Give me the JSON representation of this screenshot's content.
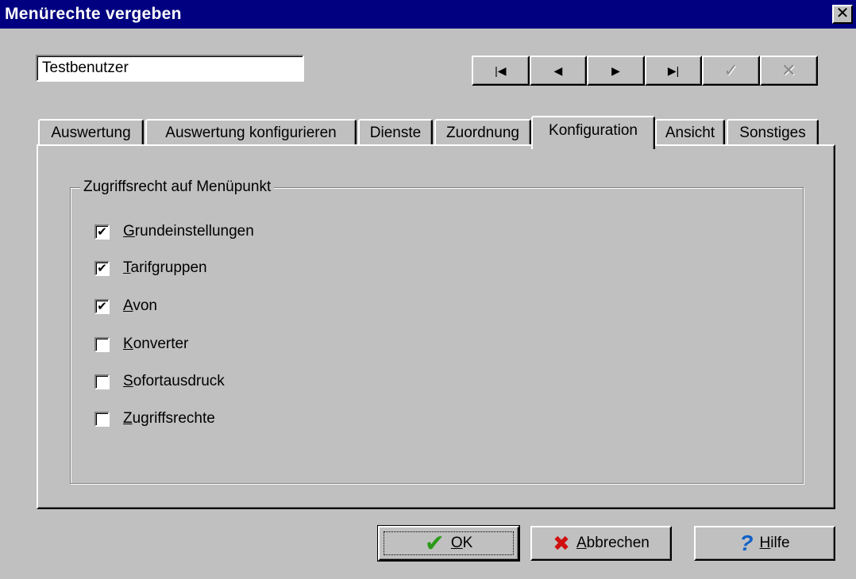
{
  "window": {
    "title": "Menürechte vergeben",
    "close_glyph": "✕"
  },
  "user_field": {
    "value": "Testbenutzer"
  },
  "navigator": {
    "buttons": [
      {
        "icon": "first-record-icon",
        "glyph": "|◀",
        "enabled": true
      },
      {
        "icon": "prior-record-icon",
        "glyph": "◀",
        "enabled": true
      },
      {
        "icon": "next-record-icon",
        "glyph": "▶",
        "enabled": true
      },
      {
        "icon": "last-record-icon",
        "glyph": "▶|",
        "enabled": true
      },
      {
        "icon": "post-check-icon",
        "glyph": "✓",
        "enabled": false
      },
      {
        "icon": "cancel-cross-icon",
        "glyph": "✕",
        "enabled": false
      }
    ]
  },
  "tabs": [
    {
      "label": "Auswertung",
      "active": false
    },
    {
      "label": "Auswertung konfigurieren",
      "active": false
    },
    {
      "label": "Dienste",
      "active": false
    },
    {
      "label": "Zuordnung",
      "active": false
    },
    {
      "label": "Konfiguration",
      "active": true
    },
    {
      "label": "Ansicht",
      "active": false
    },
    {
      "label": "Sonstiges",
      "active": false
    }
  ],
  "group": {
    "legend": "Zugriffsrecht auf Menüpunkt",
    "items": [
      {
        "accel": "G",
        "rest": "rundeinstellungen",
        "checked": true
      },
      {
        "accel": "T",
        "rest": "arifgruppen",
        "checked": true
      },
      {
        "accel": "A",
        "rest": "von",
        "checked": true
      },
      {
        "accel": "K",
        "rest": "onverter",
        "checked": false
      },
      {
        "accel": "S",
        "rest": "ofortausdruck",
        "checked": false
      },
      {
        "accel": "Z",
        "rest": "ugriffsrechte",
        "checked": false
      }
    ]
  },
  "buttons": {
    "ok": {
      "accel": "O",
      "rest": "K",
      "icon": "green-check-icon",
      "glyph": "✔"
    },
    "cancel": {
      "accel": "A",
      "rest": "bbrechen",
      "icon": "red-cross-icon",
      "glyph": "✖"
    },
    "help": {
      "accel": "H",
      "rest": "ilfe",
      "icon": "blue-question-icon",
      "glyph": "?"
    }
  },
  "colors": {
    "titlebar": "#000080",
    "face": "#c0c0c0",
    "ok_icon": "#2c9a18",
    "cancel_icon": "#d01010",
    "help_icon": "#1060c8"
  }
}
